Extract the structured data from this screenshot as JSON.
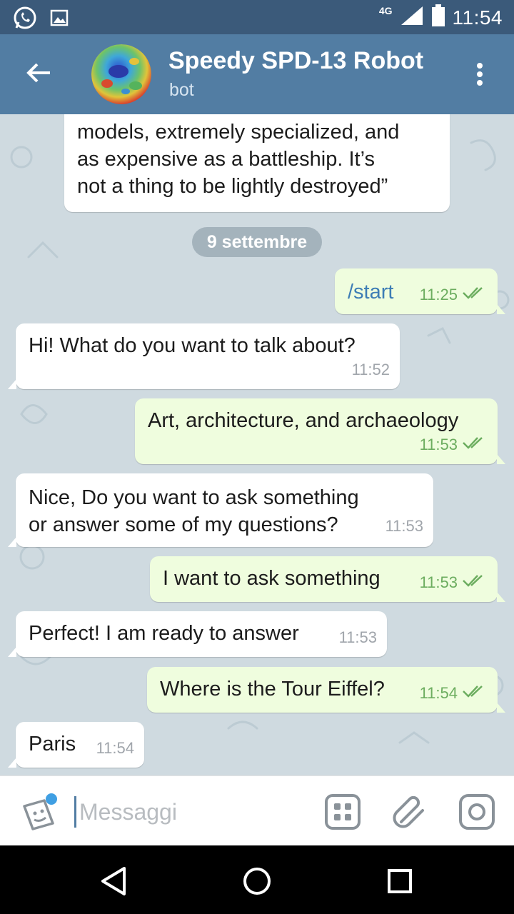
{
  "status_bar": {
    "network": "4G",
    "time": "11:54",
    "icons": [
      "whatsapp-icon",
      "image-icon",
      "signal-icon",
      "battery-icon"
    ]
  },
  "chat_header": {
    "title": "Speedy SPD-13 Robot",
    "subtitle": "bot",
    "back_icon": "arrow-left-icon",
    "menu_icon": "more-vert-icon"
  },
  "messages": [
    {
      "direction": "in",
      "text_lines": [
        "models, extremely specialized, and",
        "as expensive as a battleship. It’s",
        "not a thing to be lightly destroyed”"
      ],
      "time": ""
    },
    {
      "type": "date",
      "text": "9 settembre"
    },
    {
      "direction": "out",
      "text": "/start",
      "time": "11:25",
      "status": "read"
    },
    {
      "direction": "in",
      "text": "Hi! What do you want to talk about?",
      "time": "11:52"
    },
    {
      "direction": "out",
      "text": "Art, architecture, and archaeology",
      "time": "11:53",
      "status": "read"
    },
    {
      "direction": "in",
      "text_lines": [
        "Nice, Do you want to ask something",
        "or answer some of my questions?"
      ],
      "time": "11:53"
    },
    {
      "direction": "out",
      "text": "I want to ask something",
      "time": "11:53",
      "status": "read"
    },
    {
      "direction": "in",
      "text": "Perfect! I am ready to answer",
      "time": "11:53"
    },
    {
      "direction": "out",
      "text": "Where is the Tour Eiffel?",
      "time": "11:54",
      "status": "read"
    },
    {
      "direction": "in",
      "text": "Paris",
      "time": "11:54"
    }
  ],
  "composer": {
    "placeholder": "Messaggi",
    "value": "",
    "icons": [
      "sticker-icon",
      "bot-keyboard-icon",
      "attach-icon",
      "camera-icon"
    ]
  },
  "nav_bar": {
    "icons": [
      "back-triangle-icon",
      "home-circle-icon",
      "recents-square-icon"
    ]
  },
  "colors": {
    "status_bar": "#3b5a7a",
    "app_bar": "#527da3",
    "chat_background": "#cfdae0",
    "incoming_bubble": "#ffffff",
    "outgoing_bubble": "#effdde",
    "outgoing_meta": "#6cad5f",
    "command_link": "#3d7db5"
  }
}
